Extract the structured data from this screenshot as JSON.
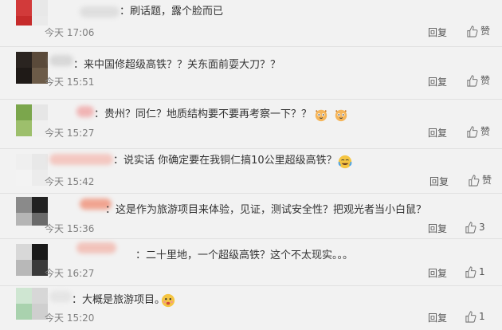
{
  "comments": [
    {
      "text": "：刷话题，露个脸而已",
      "time": "今天 17:06",
      "reply": "回复",
      "like": "赞"
    },
    {
      "text": "：来中国修超级高铁？？关东面前耍大刀？？",
      "time": "今天 15:51",
      "reply": "回复",
      "like": "赞"
    },
    {
      "text": "：贵州？同仁？地质结构要不要再考察一下？？",
      "time": "今天 15:27",
      "reply": "回复",
      "like": "赞"
    },
    {
      "text": "：说实话 你确定要在我铜仁搞10公里超级高铁？",
      "time": "今天 15:42",
      "reply": "回复",
      "like": "赞"
    },
    {
      "text": "：这是作为旅游项目来体验，见证，测试安全性？把观光者当小白鼠？",
      "time": "今天 15:36",
      "reply": "回复",
      "like": "3"
    },
    {
      "text": "：二十里地，一个超级高铁？这个不太现实。。。",
      "time": "今天 16:27",
      "reply": "回复",
      "like": "1"
    },
    {
      "text": "：大概是旅游项目。",
      "time": "今天 15:20",
      "reply": "回复",
      "like": "1"
    }
  ]
}
